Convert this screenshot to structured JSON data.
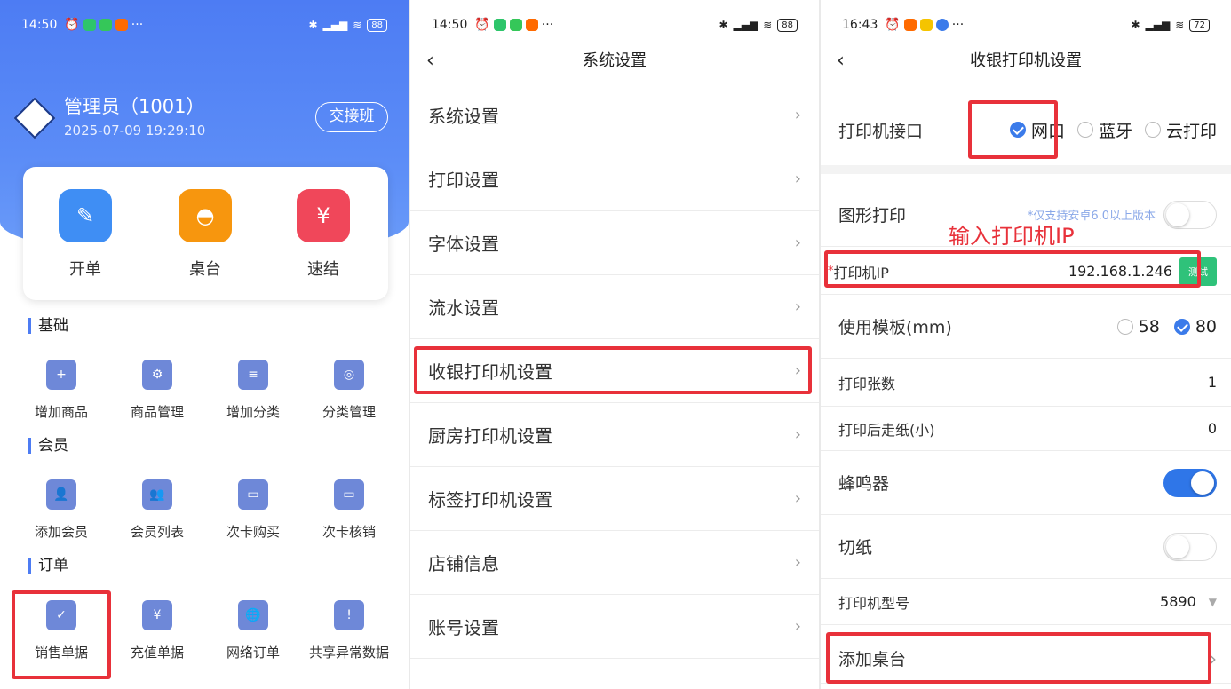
{
  "p1": {
    "status": {
      "time": "14:50",
      "dots": "···",
      "battery": "88"
    },
    "user": {
      "name": "管理员（1001）",
      "datetime": "2025-07-09 19:29:10",
      "shift_label": "交接班"
    },
    "quick": [
      {
        "label": "开单",
        "color": "#3f8ef4"
      },
      {
        "label": "桌台",
        "color": "#f7960e"
      },
      {
        "label": "速结",
        "color": "#f0475a"
      }
    ],
    "sections": {
      "base": {
        "title": "基础",
        "items": [
          "增加商品",
          "商品管理",
          "增加分类",
          "分类管理"
        ]
      },
      "member": {
        "title": "会员",
        "items": [
          "添加会员",
          "会员列表",
          "次卡购买",
          "次卡核销"
        ]
      },
      "order": {
        "title": "订单",
        "items": [
          "销售单据",
          "充值单据",
          "网络订单",
          "共享异常数据"
        ]
      }
    }
  },
  "p2": {
    "status": {
      "time": "14:50",
      "dots": "···",
      "battery": "88"
    },
    "title": "系统设置",
    "items": [
      "系统设置",
      "打印设置",
      "字体设置",
      "流水设置",
      "收银打印机设置",
      "厨房打印机设置",
      "标签打印机设置",
      "店铺信息",
      "账号设置"
    ]
  },
  "p3": {
    "status": {
      "time": "16:43",
      "dots": "···",
      "battery": "72"
    },
    "title": "收银打印机设置",
    "interface": {
      "label": "打印机接口",
      "options": [
        "网口",
        "蓝牙",
        "云打印"
      ],
      "selected": "网口"
    },
    "graphic": {
      "label": "图形打印",
      "note": "*仅支持安卓6.0以上版本",
      "on": false
    },
    "annotation": "输入打印机IP",
    "ip": {
      "label": "打印机IP",
      "star": "*",
      "value": "192.168.1.246",
      "test_label": "测试"
    },
    "template": {
      "label": "使用模板(mm)",
      "options": [
        "58",
        "80"
      ],
      "selected": "80"
    },
    "copies": {
      "label": "打印张数",
      "value": "1"
    },
    "feed": {
      "label": "打印后走纸(小)",
      "value": "0"
    },
    "buzzer": {
      "label": "蜂鸣器",
      "on": true
    },
    "cut": {
      "label": "切纸",
      "on": false
    },
    "model": {
      "label": "打印机型号",
      "value": "5890"
    },
    "add_table": {
      "label": "添加桌台"
    }
  }
}
